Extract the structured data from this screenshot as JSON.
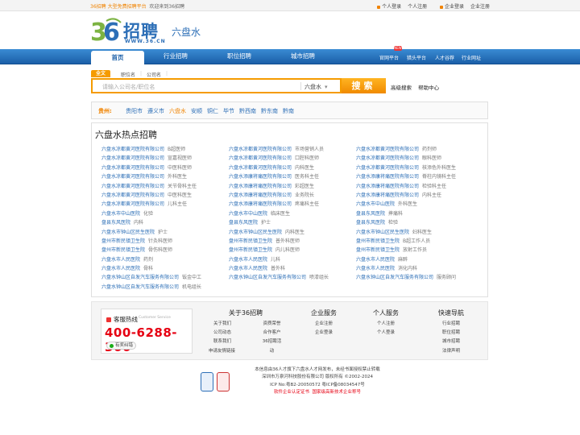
{
  "topbar": {
    "site": "36招聘",
    "slogan": "大型免费招聘平台",
    "welcome": "欢迎来到36招聘",
    "personal_login": "个人登录",
    "personal_register": "个人注册",
    "company_login": "企业登录",
    "company_register": "企业注册"
  },
  "logo": {
    "brand": "招聘",
    "url": "WWW.36.CN",
    "city": "六盘水"
  },
  "nav": {
    "home": "首页",
    "items": [
      "行业招聘",
      "职位招聘",
      "城市招聘"
    ],
    "right": [
      "官网平台",
      "猎头平台",
      "人才谷荐",
      "行业网址"
    ],
    "badge": "NEW"
  },
  "search": {
    "tab_all": "全文",
    "tab_job": "职位名",
    "tab_company": "公司名",
    "placeholder": "请输入公司名/职位名",
    "city": "六盘水",
    "button": "搜索",
    "advanced": "高级搜索",
    "help": "帮助中心"
  },
  "province": {
    "label": "贵州:",
    "cities": [
      "贵阳市",
      "遵义市",
      "六盘水",
      "安顺",
      "铜仁",
      "毕节",
      "黔西南",
      "黔东南",
      "黔南"
    ],
    "current": "六盘水"
  },
  "hot": {
    "title": "六盘水热点招聘",
    "cols": [
      [
        [
          "六盘水凉都黄河医院有限公司",
          "B超医师"
        ],
        [
          "六盘水凉都黄河医院有限公司",
          "宣嘉视医师"
        ],
        [
          "六盘水凉都黄河医院有限公司",
          "中医科医师"
        ],
        [
          "六盘水凉都黄河医院有限公司",
          "外科医生"
        ],
        [
          "六盘水凉都黄河医院有限公司",
          "关节骨科主任"
        ],
        [
          "六盘水凉都黄河医院有限公司",
          "中医科医生"
        ],
        [
          "六盘水凉都黄河医院有限公司",
          "儿科主任"
        ],
        [
          "六盘水市中山医院",
          "化验"
        ],
        [
          "盘县东风医院",
          "内科"
        ],
        [
          "六盘水市钟山区民生医院",
          "护士"
        ],
        [
          "盘州市新民镇卫生院",
          "针灸科医师"
        ],
        [
          "盘州市新民镇卫生院",
          "骨伤科医师"
        ],
        [
          "六盘水市人民医院",
          "药剂"
        ],
        [
          "六盘水市人民医院",
          "骨科"
        ],
        [
          "六盘水钟山区自发汽车服务有限公司",
          "钣金中工"
        ],
        [
          "六盘水钟山区自发汽车服务有限公司",
          "机电组长"
        ]
      ],
      [
        [
          "六盘水凉都黄河医院有限公司",
          "市场营销人员"
        ],
        [
          "六盘水凉都黄河医院有限公司",
          "口腔科医师"
        ],
        [
          "六盘水凉都黄河医院有限公司",
          "内科医生"
        ],
        [
          "六盘水添康将痛医院有限公司",
          "医务科主任"
        ],
        [
          "六盘水添康将痛医院有限公司",
          "彩超医生"
        ],
        [
          "六盘水添康将痛医院有限公司",
          "业务院长"
        ],
        [
          "六盘水添康将痛医院有限公司",
          "疼痛科主任"
        ],
        [
          "六盘水市中山医院",
          "临床医生"
        ],
        [
          "盘县东风医院",
          "护士"
        ],
        [
          "六盘水市钟山区民生医院",
          "内科医生"
        ],
        [
          "盘州市新民镇卫生院",
          "普外科医师"
        ],
        [
          "盘州市新民镇卫生院",
          "内儿科医师"
        ],
        [
          "六盘水市人民医院",
          "儿科"
        ],
        [
          "六盘水市人民医院",
          "普外科"
        ],
        [
          "六盘水钟山区自发汽车服务有限公司",
          "喷漆组长"
        ]
      ],
      [
        [
          "六盘水凉都黄河医院有限公司",
          "药剂师"
        ],
        [
          "六盘水凉都黄河医院有限公司",
          "眼科医师"
        ],
        [
          "六盘水凉都黄河医院有限公司",
          "核添色外科医生"
        ],
        [
          "六盘水添康将痛医院有限公司",
          "脊柱内镜科主任"
        ],
        [
          "六盘水添康将痛医院有限公司",
          "检验科主任"
        ],
        [
          "六盘水添康将痛医院有限公司",
          "内科主任"
        ],
        [
          "六盘水市中山医院",
          "外科医生"
        ],
        [
          "盘县东风医院",
          "摔痛科"
        ],
        [
          "盘县东风医院",
          "检验"
        ],
        [
          "六盘水市钟山区民生医院",
          "妇科医生"
        ],
        [
          "盘州市新民镇卫生院",
          "B超工作人员"
        ],
        [
          "盘州市新民镇卫生院",
          "放射工作员"
        ],
        [
          "六盘水市人民医院",
          "麻醉"
        ],
        [
          "六盘水市人民医院",
          "消化内科"
        ],
        [
          "六盘水钟山区自发汽车服务有限公司",
          "服务顾问"
        ]
      ]
    ]
  },
  "footer": {
    "hotline_label": "客服热线",
    "hotline_en": "Customer Service",
    "hotline": "400-6288-366",
    "report": "有奖纠错",
    "about_title": "关于36招聘",
    "about_a": [
      "关于我们",
      "公司动态",
      "联系我们",
      "申请友情链接"
    ],
    "about_b": [
      "资质荣誉",
      "合作客户",
      "36招聘活动"
    ],
    "company_title": "企业服务",
    "company_items": [
      "企业注册",
      "企业登录"
    ],
    "personal_title": "个人服务",
    "personal_items": [
      "个人注册",
      "个人登录"
    ],
    "quick_title": "快速导航",
    "quick_items": [
      "行业招聘",
      "职位招聘",
      "城市招聘",
      "法律声明"
    ]
  },
  "bottom": {
    "line1": "本信息由36人才旗下六盘水人才网发布，未经书面授权禁止转载",
    "line2": "深圳市万泉河科技股份有限公司 版权所有 ©2002-2024",
    "line3": "ICP No:粤B2-20050572  粤ICP备08034547号",
    "line4a": "软件企业认定证书",
    "line4b": "国家级高新技术企业称号"
  },
  "colors": {
    "brand_blue": "#2d6fb7",
    "accent_orange": "#f08300",
    "hotline_red": "#e60012"
  }
}
